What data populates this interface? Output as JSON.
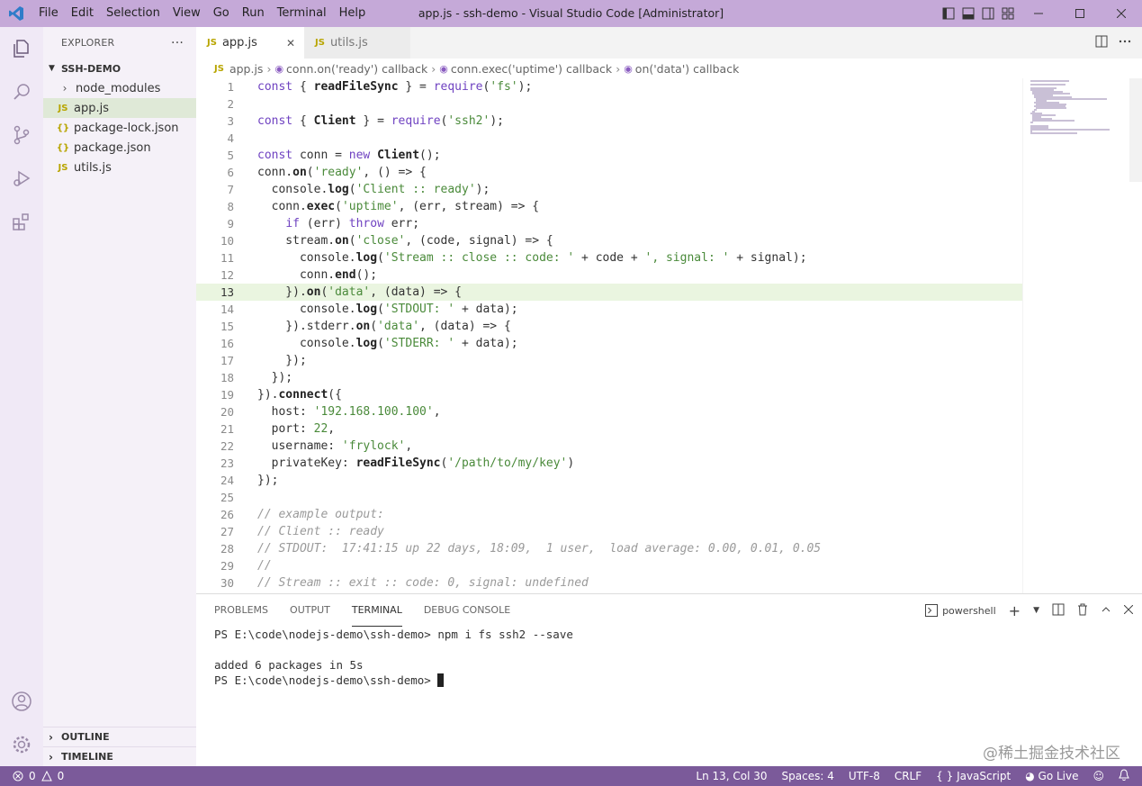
{
  "window": {
    "title": "app.js - ssh-demo - Visual Studio Code [Administrator]",
    "menu": [
      "File",
      "Edit",
      "Selection",
      "View",
      "Go",
      "Run",
      "Terminal",
      "Help"
    ]
  },
  "sidebar": {
    "header": "EXPLORER",
    "more": "···",
    "project": "SSH-DEMO",
    "files": [
      {
        "name": "node_modules",
        "icon": ">"
      },
      {
        "name": "app.js",
        "icon": "JS"
      },
      {
        "name": "package-lock.json",
        "icon": "{}"
      },
      {
        "name": "package.json",
        "icon": "{}"
      },
      {
        "name": "utils.js",
        "icon": "JS"
      }
    ],
    "outline": "OUTLINE",
    "timeline": "TIMELINE"
  },
  "tabs": [
    {
      "label": "app.js",
      "badge": "JS",
      "close": "✕"
    },
    {
      "label": "utils.js",
      "badge": "JS"
    }
  ],
  "breadcrumb": [
    "app.js",
    "conn.on('ready') callback",
    "conn.exec('uptime') callback",
    "on('data') callback"
  ],
  "editor": {
    "current_line": 13,
    "lines": [
      "const { readFileSync } = require('fs');",
      "",
      "const { Client } = require('ssh2');",
      "",
      "const conn = new Client();",
      "conn.on('ready', () => {",
      "  console.log('Client :: ready');",
      "  conn.exec('uptime', (err, stream) => {",
      "    if (err) throw err;",
      "    stream.on('close', (code, signal) => {",
      "      console.log('Stream :: close :: code: ' + code + ', signal: ' + signal);",
      "      conn.end();",
      "    }).on('data', (data) => {",
      "      console.log('STDOUT: ' + data);",
      "    }).stderr.on('data', (data) => {",
      "      console.log('STDERR: ' + data);",
      "    });",
      "  });",
      "}).connect({",
      "  host: '192.168.100.100',",
      "  port: 22,",
      "  username: 'frylock',",
      "  privateKey: readFileSync('/path/to/my/key')",
      "});",
      "",
      "// example output:",
      "// Client :: ready",
      "// STDOUT:  17:41:15 up 22 days, 18:09,  1 user,  load average: 0.00, 0.01, 0.05",
      "//",
      "// Stream :: exit :: code: 0, signal: undefined"
    ]
  },
  "panel": {
    "tabs": [
      "PROBLEMS",
      "OUTPUT",
      "TERMINAL",
      "DEBUG CONSOLE"
    ],
    "active_tab": "TERMINAL",
    "shell": "powershell",
    "terminal": [
      {
        "prompt": "PS E:\\code\\nodejs-demo\\ssh-demo>",
        "cmd": " npm i fs ssh2 --save"
      },
      {
        "prompt": "",
        "cmd": ""
      },
      {
        "prompt": "added 6 packages in 5s",
        "cmd": ""
      },
      {
        "prompt": "PS E:\\code\\nodejs-demo\\ssh-demo>",
        "cmd": " "
      }
    ],
    "watermark": "@稀土掘金技术社区"
  },
  "statusbar": {
    "errors": "0",
    "warnings": "0",
    "position": "Ln 13, Col 30",
    "spaces": "Spaces: 4",
    "encoding": "UTF-8",
    "eol": "CRLF",
    "language": "JavaScript",
    "golive": "Go Live"
  }
}
